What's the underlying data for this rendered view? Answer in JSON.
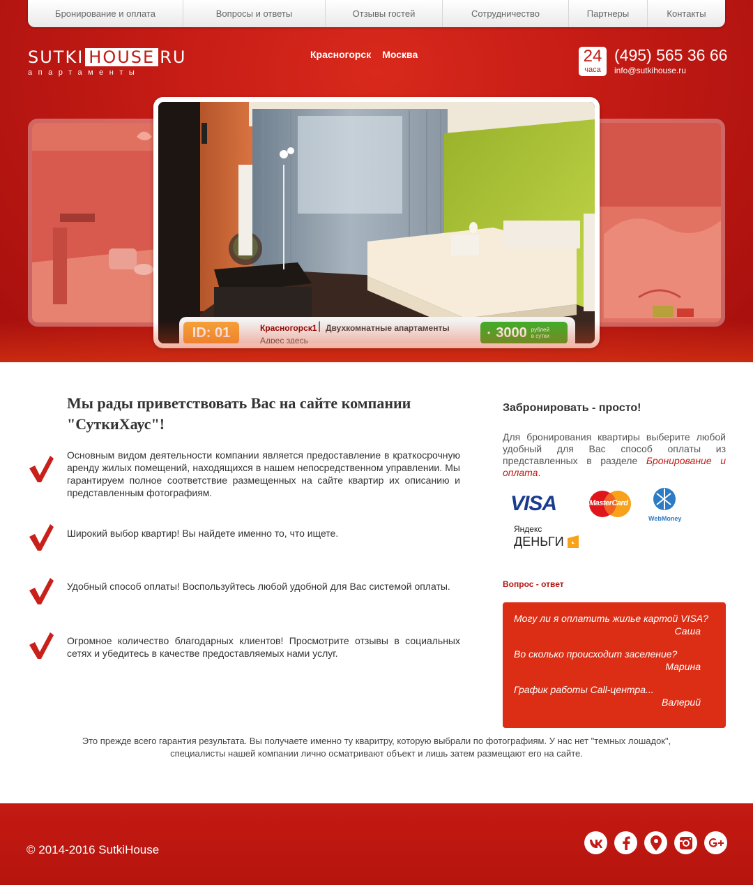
{
  "nav": [
    "Бронирование и оплата",
    "Вопросы и ответы",
    "Отзывы гостей",
    "Сотрудничество",
    "Партнеры",
    "Контакты"
  ],
  "logo": {
    "part1": "SUTKI",
    "part2": "HOUSE",
    "part3": "RU",
    "sub": "апартаменты"
  },
  "cities": [
    "Красногорск",
    "Москва"
  ],
  "contact": {
    "badge_num": "24",
    "badge_label": "часа",
    "phone": "(495) 565 36 66",
    "email": "info@sutkihouse.ru"
  },
  "slide": {
    "id": "ID: 01",
    "city": "Красногорск1",
    "separator": "|",
    "type": "Двухкомнатные апартаменты",
    "address": "Адрес здесь",
    "price_bullet": "•",
    "price": "3000",
    "price_unit_1": "рублей",
    "price_unit_2": "в сутки"
  },
  "welcome": "Мы рады приветствовать Вас на сайте компании \"СуткиХаус\"!",
  "features": [
    "Основным видом деятельности компании является предоставление в краткосрочную аренду жилых помещений, находящихся в нашем непосредственном управлении. Мы гарантируем полное соответствие размещенных на сайте квартир их описанию и представленным фотографиям.",
    "Широкий выбор квартир! Вы найдете именно то, что ищете.",
    "Удобный способ оплаты! Воспользуйтесь любой удобной для Вас системой оплаты.",
    "Огромное количество благодарных клиентов! Просмотрите отзывы в социальных сетях и убедитесь в качестве предоставляемых нами услуг."
  ],
  "booking": {
    "title": "Забронировать - просто!",
    "text": "Для бронирования квартиры выберите любой удобный для Вас способ оплаты из представленных в разделе ",
    "link": "Бронирование и оплата",
    "end": "."
  },
  "payments": {
    "visa": "VISA",
    "mastercard": "MasterCard",
    "webmoney": "WebMoney",
    "yandex_1": "Яндекс",
    "yandex_2": "ДЕНЬГИ"
  },
  "qa": {
    "title": "Вопрос - ответ",
    "items": [
      {
        "q": "Могу ли я оплатить жилье картой VISA?",
        "a": "Саша"
      },
      {
        "q": "Во сколько происходит заселение?",
        "a": "Марина"
      },
      {
        "q": "График работы Call-центра...",
        "a": "Валерий"
      }
    ]
  },
  "bottom_text_1": "Это прежде всего гарантия результата. Вы получаете именно ту кваритру, которую выбрали по фотографиям. У нас нет \"темных лошадок\",",
  "bottom_text_2": "специалисты нашей компании лично осматривают объект и лишь затем размещают его на сайте.",
  "footer": {
    "copyright": "© 2014-2016 SutkiHouse"
  },
  "social": [
    "vk-icon",
    "facebook-icon",
    "map-pin-icon",
    "instagram-icon",
    "google-plus-icon"
  ],
  "colors": {
    "brand_red": "#c21a14",
    "qa_red": "#db2e15",
    "id_orange": "#f5a33a",
    "price_green": "#3fae2a"
  }
}
